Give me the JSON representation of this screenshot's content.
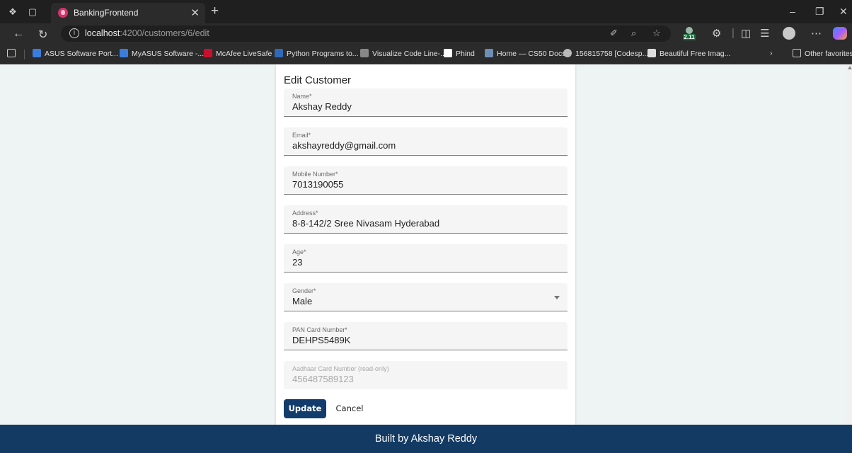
{
  "browser": {
    "tab_title": "BankingFrontend",
    "url_host": "localhost",
    "url_path": ":4200/customers/6/edit",
    "extension_badge": "2.11",
    "bookmarks": [
      "ASUS Software Port...",
      "MyASUS Software -...",
      "McAfee LiveSafe",
      "Python Programs to...",
      "Visualize Code Line-...",
      "Phind",
      "Home — CS50 Docs",
      "156815758 [Codesp...",
      "Beautiful Free Imag..."
    ],
    "other_favorites": "Other favorites"
  },
  "form": {
    "title": "Edit Customer",
    "fields": [
      {
        "label": "Name*",
        "value": "Akshay Reddy"
      },
      {
        "label": "Email*",
        "value": "akshayreddy@gmail.com"
      },
      {
        "label": "Mobile Number*",
        "value": "7013190055"
      },
      {
        "label": "Address*",
        "value": "8-8-142/2 Sree Nivasam Hyderabad"
      },
      {
        "label": "Age*",
        "value": "23"
      },
      {
        "label": "Gender*",
        "value": "Male"
      },
      {
        "label": "PAN Card Number*",
        "value": "DEHPS5489K"
      },
      {
        "label": "Aadhaar Card Number (read-only)",
        "value": "456487589123"
      }
    ],
    "update_label": "Update",
    "cancel_label": "Cancel"
  },
  "footer": {
    "text": "Built by Akshay Reddy"
  },
  "colors": {
    "primary": "#113c6b",
    "footer": "#133a63",
    "page_background": "#eef3f3"
  }
}
